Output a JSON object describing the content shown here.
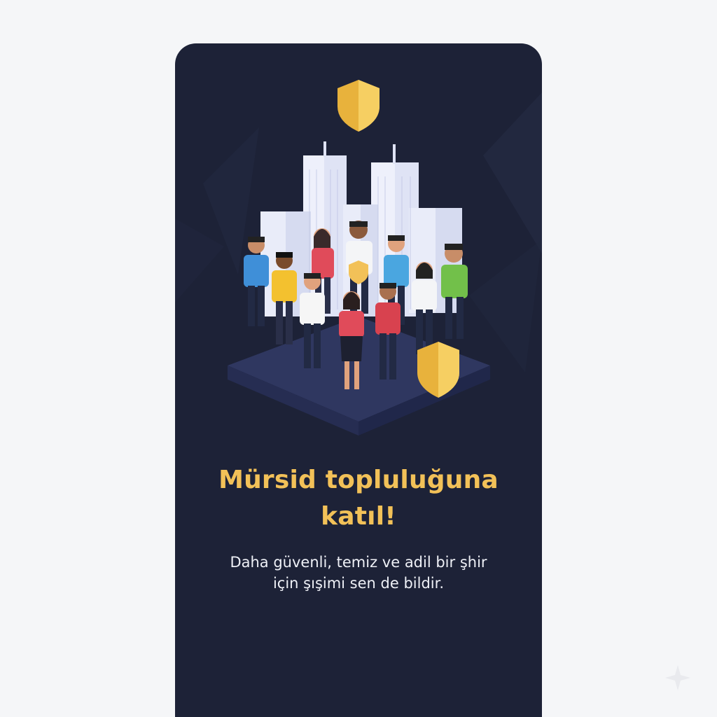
{
  "onboarding": {
    "headline_line1": "Mürsid topluluğuna",
    "headline_line2": "katıl!",
    "subtitle_line1": "Daha güvenli, temiz ve adil bir şhir",
    "subtitle_line2": "için şışimi sen de bildir."
  },
  "theme": {
    "card_background": "#1d2237",
    "accent": "#f2c158",
    "text": "#eef0f6",
    "page_background": "#f5f6f8"
  },
  "icons": [
    "shield-icon",
    "sparkle-icon"
  ]
}
